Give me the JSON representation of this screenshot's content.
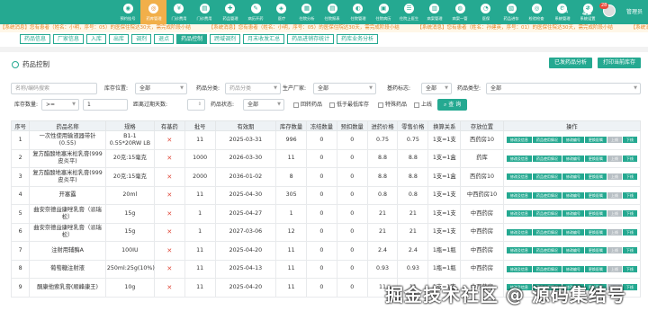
{
  "nav": {
    "items": [
      {
        "label": "预约挂号",
        "icon": "◉"
      },
      {
        "label": "药库管理",
        "icon": "◎"
      },
      {
        "label": "门诊费用",
        "icon": "¥"
      },
      {
        "label": "门诊费用",
        "icon": "▤"
      },
      {
        "label": "药品管理",
        "icon": "✚"
      },
      {
        "label": "病历开药",
        "icon": "✎"
      },
      {
        "label": "医疗",
        "icon": "◈"
      },
      {
        "label": "住院分析",
        "icon": "▦"
      },
      {
        "label": "住院报表",
        "icon": "▤"
      },
      {
        "label": "住院管理",
        "icon": "◐"
      },
      {
        "label": "住院病历",
        "icon": "▣"
      },
      {
        "label": "住院上医生",
        "icon": "☰"
      },
      {
        "label": "病案管理",
        "icon": "▥"
      },
      {
        "label": "病案一管",
        "icon": "◍"
      },
      {
        "label": "医保",
        "icon": "◔"
      },
      {
        "label": "药品进存",
        "icon": "▧"
      },
      {
        "label": "检验检查",
        "icon": "◎"
      },
      {
        "label": "系统管理",
        "icon": "⚙"
      },
      {
        "label": "系统设置",
        "icon": "✱"
      }
    ],
    "active_index": 1,
    "edit_icon": "pencil-icon",
    "bell_icon": "bell-icon",
    "notification_count": "28",
    "user": "管理员"
  },
  "notice": [
    "【系统消息】您有患者（姓名：小明，序号：05）的医保住院达30天，需完成阶段小结",
    "【系统消息】您有患者（姓名：小明，序号：05）的医保住院达30天，需完成阶段小结",
    "【系统消息】您有患者（姓名：孙建英，序号：01）的医保住院达30天，需完成阶段小结",
    "【系统消息】您有患者（姓名："
  ],
  "tabs": [
    "药品信息",
    "厂家信息",
    "入库",
    "出库",
    "调剂",
    "退点",
    "药品控制",
    "跨域调剂",
    "月末收发汇总",
    "药品进销存统计",
    "药库业务分析"
  ],
  "active_tab": 6,
  "section": {
    "title": "药品控制",
    "btn_analysis": "已发药品分析",
    "btn_print": "打印当前库存"
  },
  "filters": {
    "name_placeholder": "名称/编码搜索",
    "location_label": "库存位置:",
    "location_value": "全部",
    "category_label": "药品分类:",
    "category_placeholder": "药品分类",
    "manufacturer_label": "生产厂家:",
    "manufacturer_value": "全部",
    "basedrug_label": "基药标志:",
    "basedrug_value": "全部",
    "type_label": "药品类型:",
    "type_value": "全部",
    "stock_label": "库存数量:",
    "stock_op": ">=",
    "stock_value": "1",
    "expiry_label": "距离过期天数:",
    "status_label": "药品状态:",
    "status_value": "全部",
    "cb_recycle": "回转药品",
    "cb_lowstock": "低于最低库存",
    "cb_special": "特殊药品",
    "cb_up": "上线",
    "search_btn": "查 询"
  },
  "table": {
    "headers": [
      "序号",
      "药品名称",
      "规格",
      "有基药",
      "批号",
      "有效期",
      "库存数量",
      "冻结数量",
      "预扣数量",
      "进药价格",
      "零售价格",
      "换算关系",
      "存放位置",
      "操作"
    ],
    "ops_labels": [
      "修改及信息",
      "药品使用情况",
      "修改编号",
      "更换医嘱",
      "上线",
      "下线"
    ],
    "rows": [
      {
        "no": "1",
        "name": "一次性使用输液器带针(0.55)",
        "spec": "B1-1 0.55*20RW LB",
        "base": "✕",
        "batch": "11",
        "expiry": "2025-03-31",
        "stock": "996",
        "frozen": "0",
        "pre": "0",
        "buy": "0.75",
        "retail": "0.75",
        "conv": "1支=1支",
        "loc": "西药房10"
      },
      {
        "no": "2",
        "name": "复方醋酸地塞米松乳膏(999皮炎平)",
        "spec": "20克:15毫克",
        "base": "✕",
        "batch": "1000",
        "expiry": "2026-03-30",
        "stock": "11",
        "frozen": "0",
        "pre": "0",
        "buy": "8.8",
        "retail": "8.8",
        "conv": "1支=1盒",
        "loc": "药库"
      },
      {
        "no": "3",
        "name": "复方醋酸地塞米松乳膏(999皮炎平)",
        "spec": "20克:15毫克",
        "base": "✕",
        "batch": "2000",
        "expiry": "2036-01-02",
        "stock": "8",
        "frozen": "0",
        "pre": "0",
        "buy": "8.8",
        "retail": "8.8",
        "conv": "1支=1盒",
        "loc": "西药房10"
      },
      {
        "no": "4",
        "name": "开塞露",
        "spec": "20ml",
        "base": "✕",
        "batch": "11",
        "expiry": "2025-04-30",
        "stock": "305",
        "frozen": "0",
        "pre": "0",
        "buy": "0.8",
        "retail": "0.8",
        "conv": "1支=1支",
        "loc": "中西药房10"
      },
      {
        "no": "5",
        "name": "曲安奈德益康唑乳膏（派瑞松）",
        "spec": "15g",
        "base": "✕",
        "batch": "1",
        "expiry": "2025-04-27",
        "stock": "1",
        "frozen": "0",
        "pre": "0",
        "buy": "21",
        "retail": "21",
        "conv": "1支=1支",
        "loc": "中西药房"
      },
      {
        "no": "6",
        "name": "曲安奈德益康唑乳膏（派瑞松）",
        "spec": "15g",
        "base": "✕",
        "batch": "1",
        "expiry": "2027-03-06",
        "stock": "12",
        "frozen": "0",
        "pre": "0",
        "buy": "21",
        "retail": "21",
        "conv": "1支=1支",
        "loc": "中西药房"
      },
      {
        "no": "7",
        "name": "注射用辅酶A",
        "spec": "100IU",
        "base": "✕",
        "batch": "11",
        "expiry": "2025-04-20",
        "stock": "11",
        "frozen": "0",
        "pre": "0",
        "buy": "2.4",
        "retail": "2.4",
        "conv": "1瓶=1瓶",
        "loc": "中西药房"
      },
      {
        "no": "8",
        "name": "葡萄糖注射液",
        "spec": "250ml:25g(10%)",
        "base": "✕",
        "batch": "11",
        "expiry": "2025-04-13",
        "stock": "11",
        "frozen": "0",
        "pre": "0",
        "buy": "0.93",
        "retail": "0.93",
        "conv": "1瓶=1瓶",
        "loc": "中西药房"
      },
      {
        "no": "9",
        "name": "酮康他索乳膏(顺峰康王)",
        "spec": "10g",
        "base": "✕",
        "batch": "11",
        "expiry": "2025-04-20",
        "stock": "11",
        "frozen": "0",
        "pre": "0",
        "buy": "11",
        "retail": "11",
        "conv": "1支=1支",
        "loc": "中西药房"
      }
    ]
  },
  "watermark": "掘金技术社区 @ 源码集结号"
}
